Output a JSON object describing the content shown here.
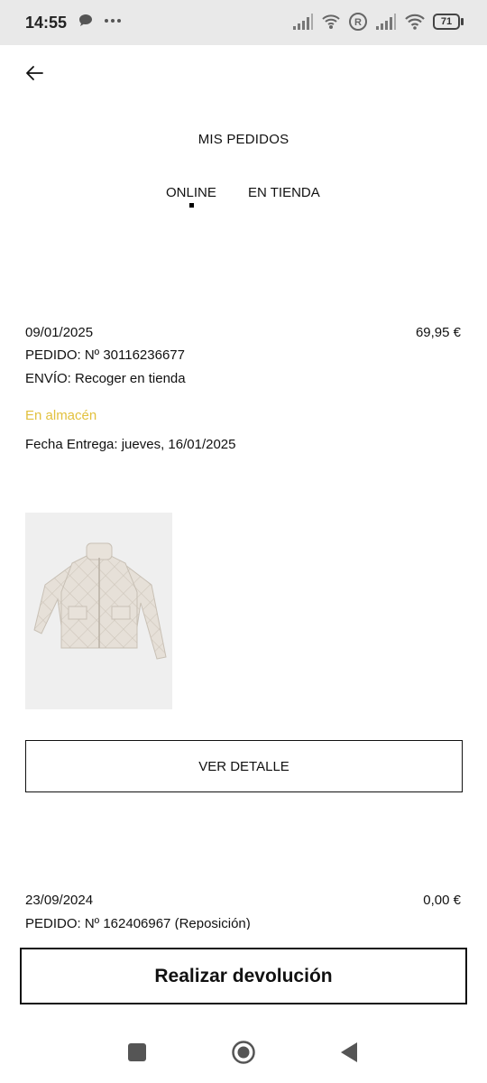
{
  "status_bar": {
    "time": "14:55",
    "battery": "71"
  },
  "header": {
    "title": "MIS PEDIDOS"
  },
  "tabs": [
    {
      "label": "ONLINE",
      "active": true
    },
    {
      "label": "EN TIENDA",
      "active": false
    }
  ],
  "orders": [
    {
      "date": "09/01/2025",
      "amount": "69,95 €",
      "order_line": "PEDIDO: Nº 30116236677",
      "shipping_line": "ENVÍO: Recoger en tienda",
      "status": "En almacén",
      "status_color": "#e2c13e",
      "delivery": "Fecha Entrega: jueves, 16/01/2025",
      "product_image": "quilted-jacket",
      "detail_button": "VER DETALLE"
    },
    {
      "date": "23/09/2024",
      "amount": "0,00 €",
      "order_line": "PEDIDO: Nº 162406967 (Reposición)"
    }
  ],
  "footer": {
    "return_button": "Realizar devolución"
  },
  "nav_bar": {
    "icons": [
      "recent-apps-icon",
      "home-icon",
      "back-triangle-icon"
    ]
  }
}
